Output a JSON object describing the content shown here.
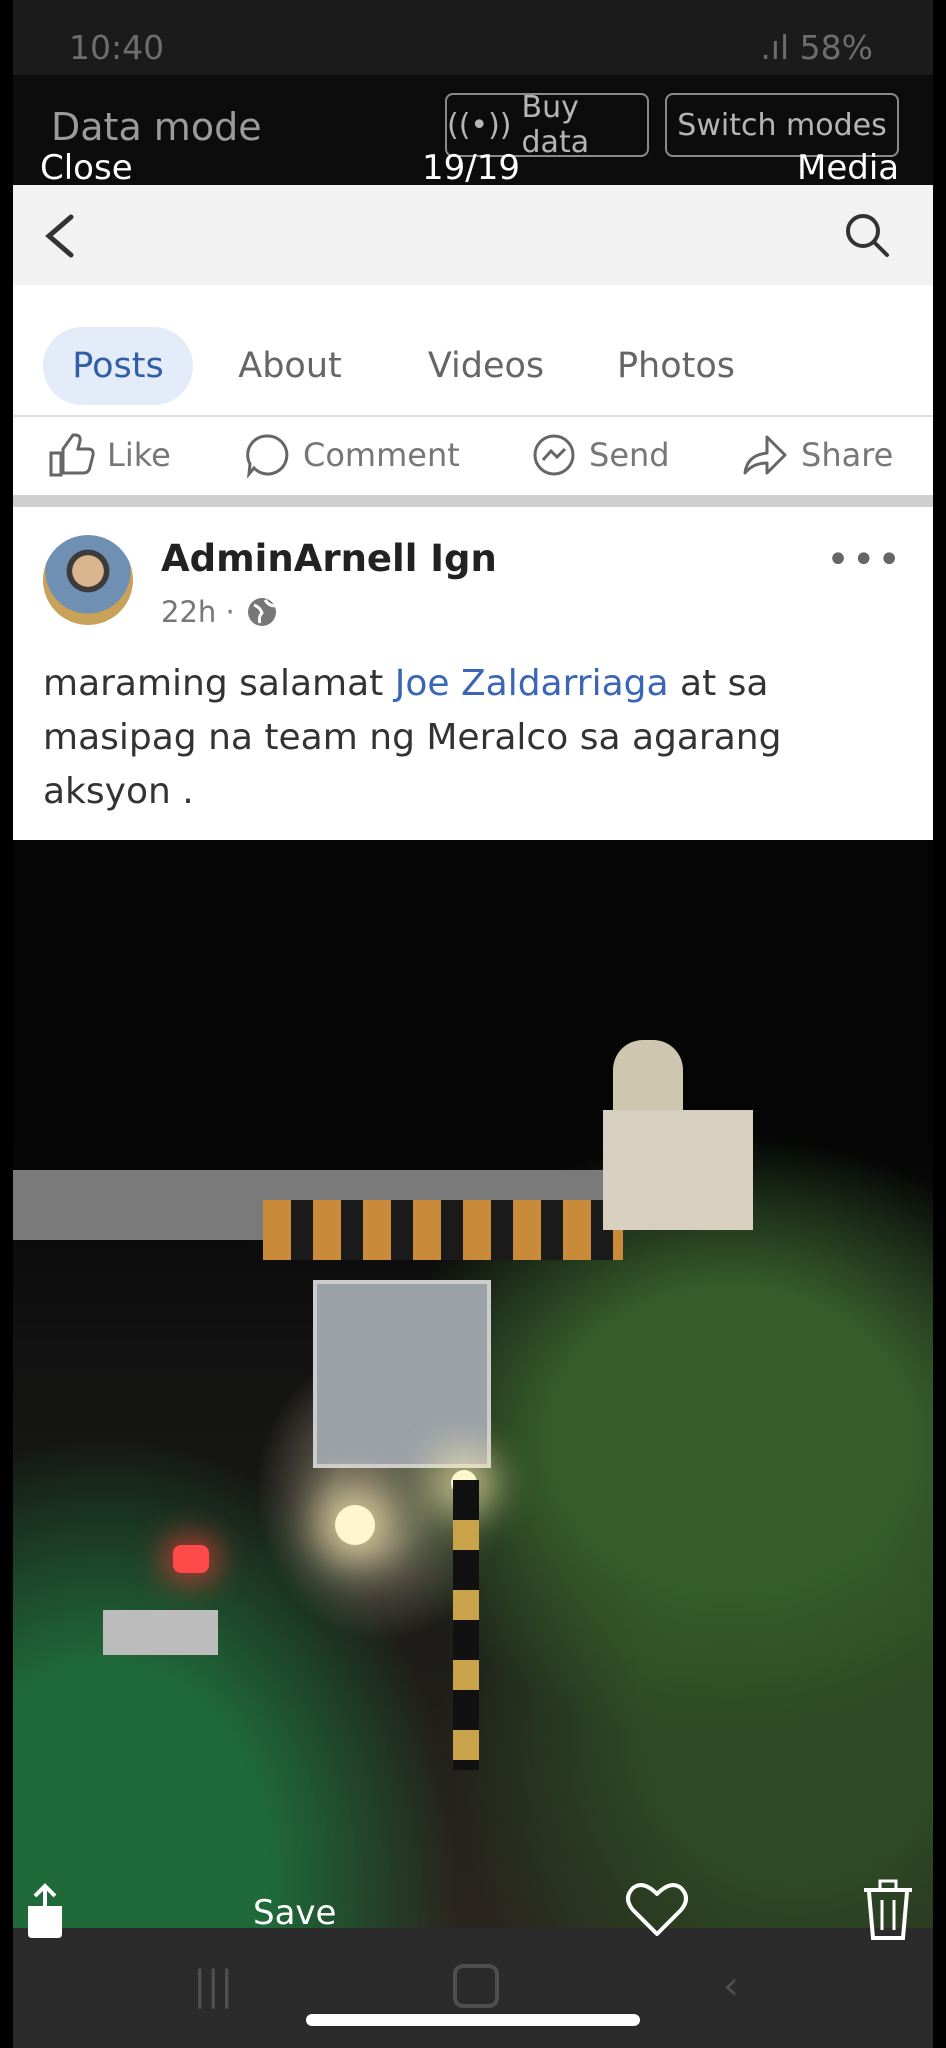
{
  "viewer": {
    "close_label": "Close",
    "counter": "19/19",
    "media_label": "Media",
    "save_label": "Save"
  },
  "status_bar": {
    "time": "10:40",
    "battery": "58%"
  },
  "data_mode": {
    "title": "Data mode",
    "buy_data": "Buy data",
    "switch_modes": "Switch modes"
  },
  "page": {
    "tabs": [
      "Posts",
      "About",
      "Videos",
      "Photos"
    ],
    "active_tab": "Posts",
    "actions": [
      "Like",
      "Comment",
      "Send",
      "Share"
    ]
  },
  "post": {
    "author": "AdminArnell Ign",
    "time": "22h ·",
    "text_before_link": "maraming salamat ",
    "link_text": "Joe Zaldarriaga",
    "text_after_link": "  at sa masipag na team ng Meralco sa agarang aksyon ."
  },
  "colors": {
    "accent": "#3b66b8",
    "active_tab_bg": "#e3ecf8"
  }
}
